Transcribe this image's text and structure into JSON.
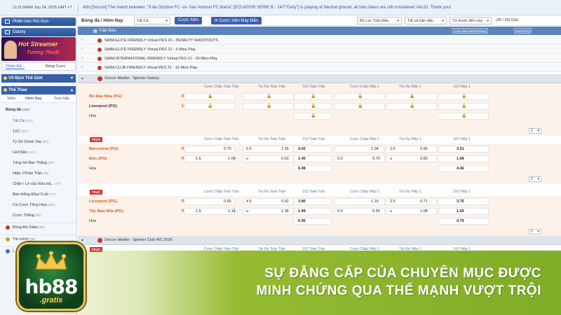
{
  "topbar": {
    "time": "11:11:56AM July 24, 2025 GMT +7",
    "ticker": "Attn:[Soccer] The match between, \"9 de Octubre FC -vs- San Antonio FC Ibarra\" [ECUADOR SERIE B - 24/7\"Early\"] is playing at Neutral ground, all bets taken are still considered VALID. Thank you!"
  },
  "sidebar": {
    "btn1": "Phiên bản Rút Gọn",
    "btn2": "Galaxy",
    "banner_line1": "Hot Streamer",
    "banner_line2": "Tường Thuật",
    "tab_slip": "Phiếu Đặ...",
    "tab_statement": "Bảng Cược",
    "sec_worldcup": "Vô Địch Thế Giới",
    "sec_sports": "Thể Thao",
    "sub_early": "Sớm",
    "sub_today": "Hôm Nay",
    "sub_live": "Trực tiếp",
    "football": "Bóng đá",
    "football_count": "(183)",
    "items": [
      {
        "label": "Tất Cả",
        "count": "(177)"
      },
      {
        "label": "1X2",
        "count": "(107)"
      },
      {
        "label": "Tỷ Số Chính Xác",
        "count": "(97)"
      },
      {
        "label": "Lẻ/Chẵn",
        "count": "(117)"
      },
      {
        "label": "Tổng Số Bàn Thắng",
        "count": "(97)"
      },
      {
        "label": "Hiệp 1/Toàn Trận",
        "count": "(78)"
      },
      {
        "label": "Chẵn / Lẻ của Nửa trậ...",
        "count": "(77)"
      },
      {
        "label": "Bàn thắng Đầu/ Cuối",
        "count": "(77)"
      },
      {
        "label": "Cá Cược Tổng Hợp",
        "count": "(117)"
      },
      {
        "label": "Cược Thắng",
        "count": "(61)"
      }
    ],
    "saba": "Bóng Đá Saba",
    "saba_count": "(30)",
    "finance": "Tài chính",
    "finance_count": "(38)",
    "more": "L"
  },
  "toolbar": {
    "title": "Bóng đá / Hôm Nay",
    "filter_all": "Tất Cả",
    "parlay_btn": "Cược Xiên",
    "lucky_btn": "Cược Xiên May Mắn",
    "league_filter": "Bộ Lọc Trận Đấu",
    "all_matches": "Tất cả trận đấu",
    "sort": "Từ trước đến nay",
    "count": "(30 / 30) Giải"
  },
  "header": {
    "title": "Trận Đấu",
    "select1": "Lựa chọn bình thường",
    "select2": "Hai Dòng"
  },
  "virtual_leagues": [
    "SABA ELITE FRIENDLY Virtual PES 23 - PENALTY SHOOTOUTS",
    "SABA ELITE FRIENDLY Virtual PES 21 - 5 Mins Play",
    "SABA INTERNATIONAL FRIENDLY Virtual PES 21 - 20 Mins Play",
    "SABA CLUB FRIENDLY Virtual PES 21 - 15 Mins Play"
  ],
  "league1": "Soccer Marble - Spinner Galaxy",
  "league2": "Soccer Marble - Spinner Club WC 2025",
  "columns": [
    "Cược Chấp Toàn Trận",
    "Tài Xỉu Toàn Trận",
    "1X2 Toàn Trận",
    "Cược Chấp Hiệp 1",
    "Tài Xỉu Hiệp 1",
    "1X2 Hiệp 1"
  ],
  "live_label": "TRỰC",
  "draw_label": "Hòa",
  "page_sel": "2",
  "match1": {
    "home": "Bồ Đào Nha (PG)",
    "home_score": "0",
    "away": "Liverpool (PG)",
    "away_score": "1"
  },
  "match2": {
    "home": "Barcelona (PG)",
    "home_score": "0",
    "away": "Đức (PG)",
    "away_score": "0",
    "r1": [
      "0.70",
      "0.5",
      "1.35",
      "4.02",
      "1.04",
      "2.5",
      "0.96",
      "3.51"
    ],
    "r2": [
      "1.5",
      "1.09",
      "u",
      "0.53",
      "1.40",
      "0.0",
      "0.70",
      "u",
      "0.83",
      "1.68"
    ],
    "r3": [
      "6.08",
      "4.46"
    ]
  },
  "match3": {
    "home": "Liverpool (PG)",
    "home_score": "0",
    "away": "Tây Ban Nha (PG)",
    "away_score": "0",
    "r1": [
      "0.65",
      "4.5",
      "0.52",
      "3.80",
      "1.16",
      "2.5",
      "0.71",
      "3.76"
    ],
    "r2": [
      "1.5",
      "1.16",
      "u",
      "1.36",
      "1.49",
      "0.0",
      "0.65",
      "u",
      "1.08",
      "1.09"
    ],
    "r3": [
      "5.95",
      "4.79"
    ]
  },
  "overlay": {
    "line1": "SỰ ĐẲNG CẤP CỦA CHUYÊN MỤC ĐƯỢC",
    "line2": "MINH CHỨNG QUA THẾ MẠNH VƯỢT TRỘI"
  },
  "logo": {
    "brand": "hb88",
    "sub": ".gratis"
  }
}
